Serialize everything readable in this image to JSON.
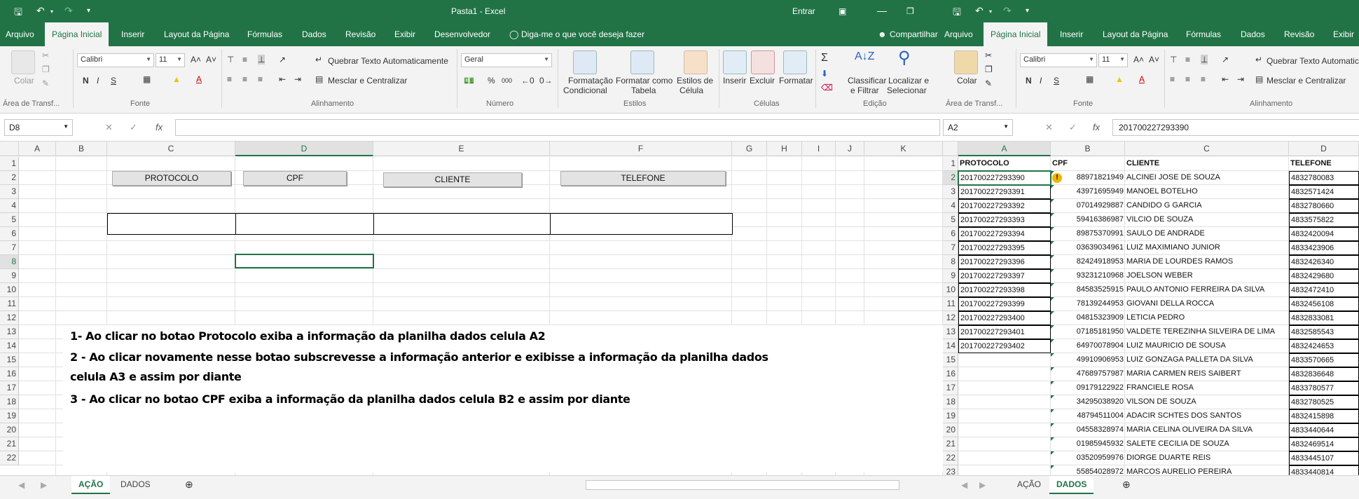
{
  "left": {
    "titlebar": {
      "quick_save": "save-icon",
      "title": "Pasta1  -  Excel",
      "entrar": "Entrar"
    },
    "ribbon_tabs": [
      "Arquivo",
      "Página Inicial",
      "Inserir",
      "Layout da Página",
      "Fórmulas",
      "Dados",
      "Revisão",
      "Exibir",
      "Desenvolvedor"
    ],
    "tell_me": "Diga-me o que você deseja fazer",
    "share": "Compartilhar",
    "ribbon": {
      "paste": "Colar",
      "font_name": "Calibri",
      "font_size": "11",
      "wrap_text": "Quebrar Texto Automaticamente",
      "merge_center": "Mesclar e Centralizar",
      "number_format": "Geral",
      "cond_format_1": "Formatação",
      "cond_format_2": "Condicional",
      "format_table_1": "Formatar como",
      "format_table_2": "Tabela",
      "cell_styles_1": "Estilos de",
      "cell_styles_2": "Célula",
      "insert": "Inserir",
      "delete": "Excluir",
      "format": "Formatar",
      "sort_1": "Classificar",
      "sort_2": "e Filtrar",
      "find_1": "Localizar e",
      "find_2": "Selecionar",
      "groups": {
        "clipboard": "Área de Transf...",
        "font": "Fonte",
        "alignment": "Alinhamento",
        "number": "Número",
        "styles": "Estilos",
        "cells": "Células",
        "editing": "Edição"
      }
    },
    "name_box": "D8",
    "formula": "",
    "columns": [
      "A",
      "B",
      "C",
      "D",
      "E",
      "F",
      "G",
      "H",
      "I",
      "J",
      "K"
    ],
    "rows": [
      "1",
      "2",
      "3",
      "4",
      "5",
      "6",
      "7",
      "8",
      "9",
      "10",
      "11",
      "12",
      "13",
      "14",
      "15",
      "16",
      "17",
      "18",
      "19",
      "20",
      "21",
      "22"
    ],
    "buttons": {
      "protocolo": "PROTOCOLO",
      "cpf": "CPF",
      "cliente": "CLIENTE",
      "telefone": "TELEFONE"
    },
    "notes": [
      "1- Ao clicar no botao Protocolo exiba a informação da planilha dados celula A2",
      "2 - Ao clicar novamente nesse botao subscrevesse a informação anterior e exibisse a informação da planilha dados",
      "celula A3 e assim por diante",
      "3 - Ao clicar no botao CPF exiba a informação da planilha dados celula B2 e assim por diante"
    ],
    "sheets": [
      "AÇÃO",
      "DADOS"
    ]
  },
  "right": {
    "ribbon_tabs": [
      "Arquivo",
      "Página Inicial",
      "Inserir",
      "Layout da Página",
      "Fórmulas",
      "Dados",
      "Revisão",
      "Exibir"
    ],
    "ribbon": {
      "paste": "Colar",
      "font_name": "Calibri",
      "font_size": "11",
      "wrap_text": "Quebrar Texto Automatic",
      "merge_center": "Mesclar e Centralizar",
      "groups": {
        "clipboard": "Área de Transf...",
        "font": "Fonte",
        "alignment": "Alinhamento"
      }
    },
    "name_box": "A2",
    "formula": "201700227293390",
    "columns": [
      "A",
      "B",
      "C",
      "D"
    ],
    "rows": [
      "1",
      "2",
      "3",
      "4",
      "5",
      "6",
      "7",
      "8",
      "9",
      "10",
      "11",
      "12",
      "13",
      "14",
      "15",
      "16",
      "17",
      "18",
      "19",
      "20",
      "21",
      "22",
      "23"
    ],
    "header": [
      "PROTOCOLO",
      "CPF",
      "CLIENTE",
      "TELEFONE"
    ],
    "data": [
      [
        "201700227293390",
        "88971821949",
        "ALCINEI JOSE DE SOUZA",
        "4832780083"
      ],
      [
        "201700227293391",
        "43971695949",
        "MANOEL BOTELHO",
        "4832571424"
      ],
      [
        "201700227293392",
        "07014929887",
        "CANDIDO G GARCIA",
        "4832780660"
      ],
      [
        "201700227293393",
        "59416386987",
        "VILCIO DE SOUZA",
        "4833575822"
      ],
      [
        "201700227293394",
        "89875370991",
        "SAULO DE ANDRADE",
        "4832420094"
      ],
      [
        "201700227293395",
        "03639034961",
        "LUIZ MAXIMIANO JUNIOR",
        "4833423906"
      ],
      [
        "201700227293396",
        "82424918953",
        "MARIA DE LOURDES RAMOS",
        "4832426340"
      ],
      [
        "201700227293397",
        "93231210968",
        "JOELSON WEBER",
        "4832429680"
      ],
      [
        "201700227293398",
        "84583525915",
        "PAULO ANTONIO FERREIRA DA SILVA",
        "4832472410"
      ],
      [
        "201700227293399",
        "78139244953",
        "GIOVANI DELLA ROCCA",
        "4832456108"
      ],
      [
        "201700227293400",
        "04815323909",
        "LETICIA PEDRO",
        "4832833081"
      ],
      [
        "201700227293401",
        "07185181950",
        "VALDETE TEREZINHA SILVEIRA DE LIMA",
        "4832585543"
      ],
      [
        "201700227293402",
        "64970078904",
        "LUIZ MAURICIO DE SOUSA",
        "4832424653"
      ],
      [
        "",
        "49910906953",
        "LUIZ GONZAGA PALLETA DA SILVA",
        "4833570665"
      ],
      [
        "",
        "47689757987",
        "MARIA CARMEN REIS SAIBERT",
        "4832836648"
      ],
      [
        "",
        "09179122922",
        "FRANCIELE ROSA",
        "4833780577"
      ],
      [
        "",
        "34295038920",
        "VILSON DE SOUZA",
        "4832780525"
      ],
      [
        "",
        "48794511004",
        "ADACIR SCHTES DOS SANTOS",
        "4832415898"
      ],
      [
        "",
        "04558328974",
        "MARIA CELINA OLIVEIRA DA SILVA",
        "4833440644"
      ],
      [
        "",
        "01985945932",
        "SALETE CECILIA DE SOUZA",
        "4832469514"
      ],
      [
        "",
        "03520959976",
        "DIORGE DUARTE REIS",
        "4833445107"
      ],
      [
        "",
        "55854028972",
        "MARCOS AURELIO PEREIRA",
        "4833440814"
      ]
    ],
    "sheets": [
      "AÇÃO",
      "DADOS"
    ]
  }
}
